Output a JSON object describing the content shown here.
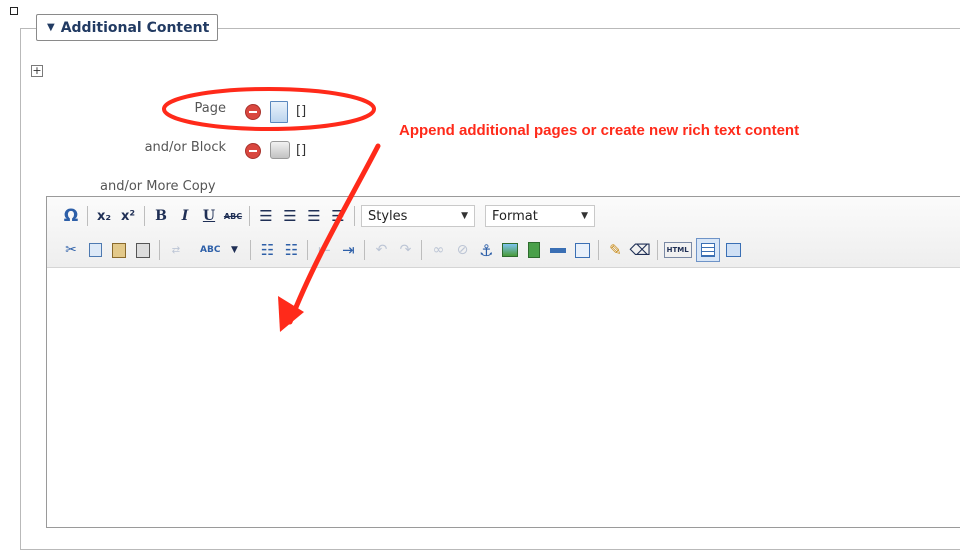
{
  "section": {
    "title": "Additional Content",
    "expand_symbol": "+"
  },
  "fields": {
    "page_label": "Page",
    "page_value": "[]",
    "block_label": "and/or Block",
    "block_value": "[]",
    "copy_label": "and/or More Copy"
  },
  "editor": {
    "toolbar_row1": {
      "special_char": "Ω",
      "subscript": "x₂",
      "superscript": "x²",
      "bold": "B",
      "italic": "I",
      "underline": "U",
      "strike": "ABC",
      "styles_value": "Styles",
      "format_value": "Format"
    },
    "toolbar_row2": {
      "html_source": "HTML",
      "spellcheck": "ABC"
    }
  },
  "annotation": {
    "text": "Append additional pages or create new rich text content",
    "color": "#ff2a1a"
  }
}
